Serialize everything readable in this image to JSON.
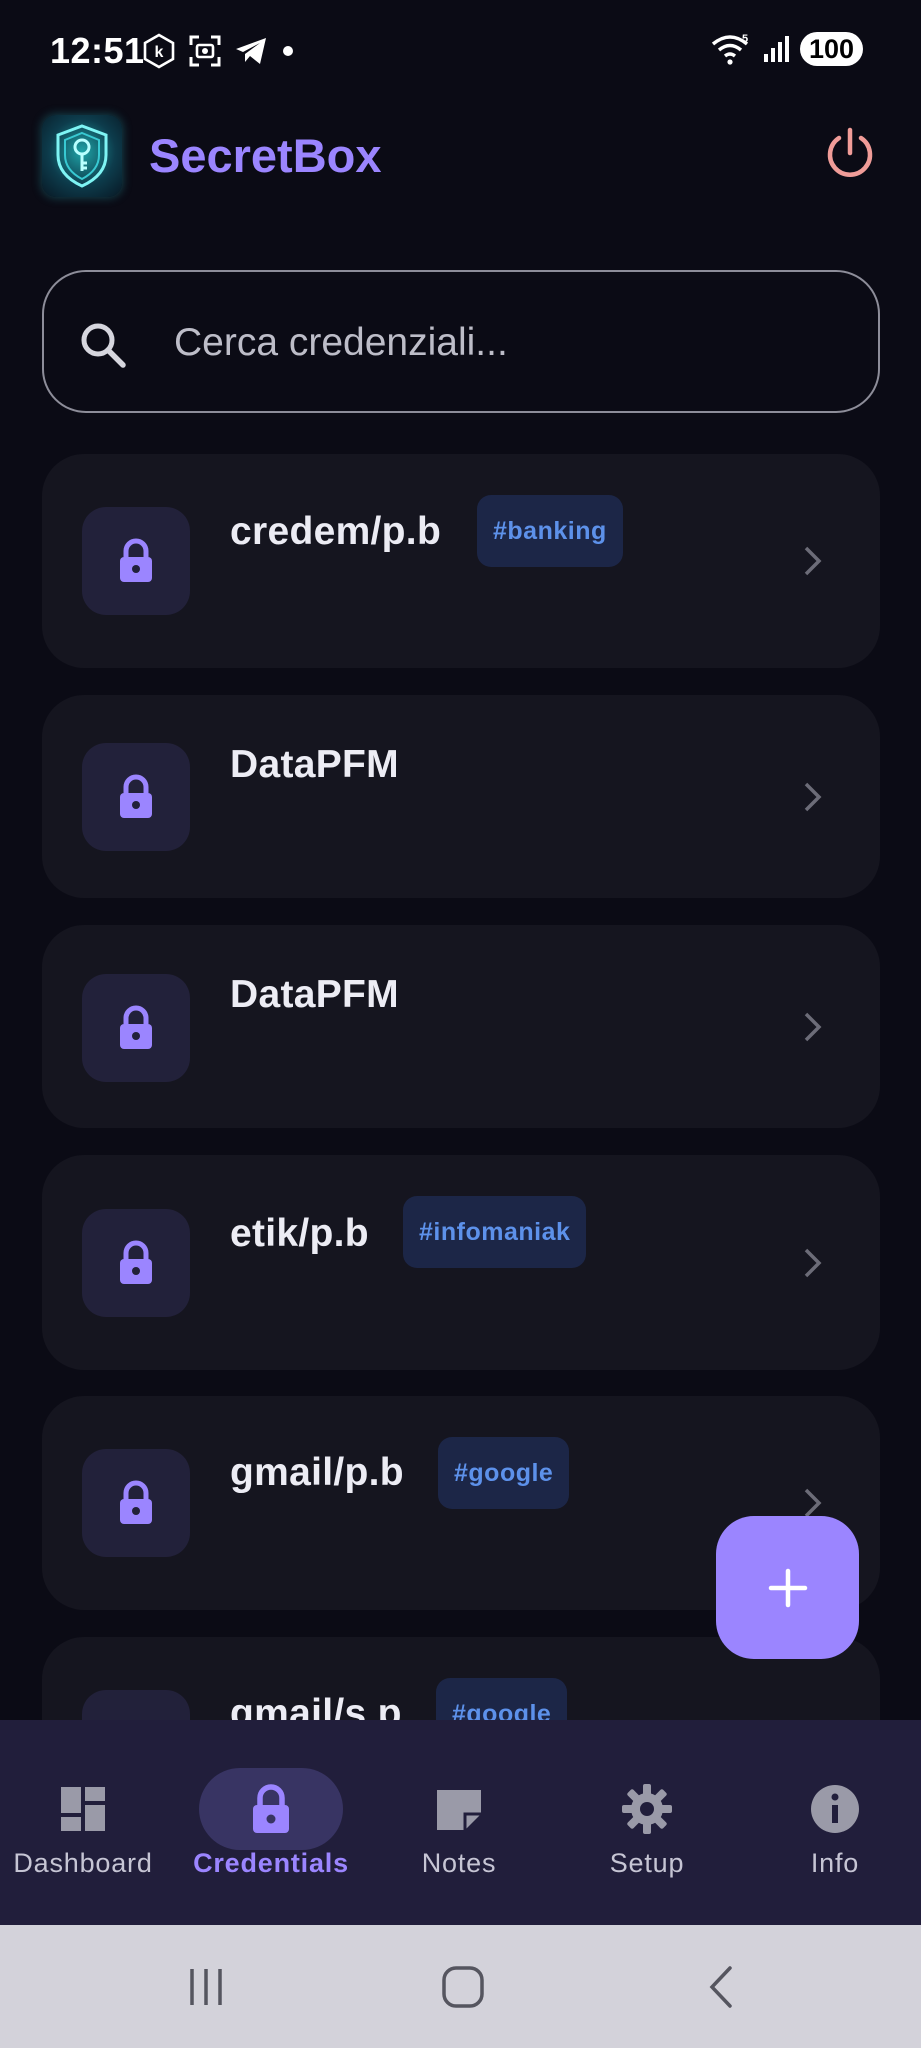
{
  "status_bar": {
    "time": "12:51",
    "battery": "100"
  },
  "header": {
    "title": "SecretBox"
  },
  "search": {
    "placeholder": "Cerca credenziali..."
  },
  "credentials": [
    {
      "title": "credem/p.b",
      "tag": "#banking"
    },
    {
      "title": "DataPFM",
      "tag": ""
    },
    {
      "title": "DataPFM",
      "tag": ""
    },
    {
      "title": "etik/p.b",
      "tag": "#infomaniak"
    },
    {
      "title": "gmail/p.b",
      "tag": "#google"
    },
    {
      "title": "gmail/s.p",
      "tag": "#google"
    }
  ],
  "fab": {
    "label": "+"
  },
  "nav": {
    "items": [
      {
        "label": "Dashboard",
        "icon": "dashboard-icon"
      },
      {
        "label": "Credentials",
        "icon": "lock-icon"
      },
      {
        "label": "Notes",
        "icon": "note-icon"
      },
      {
        "label": "Setup",
        "icon": "gear-icon"
      },
      {
        "label": "Info",
        "icon": "info-icon"
      }
    ],
    "active": "Credentials"
  },
  "colors": {
    "background": "#0b0b15",
    "card": "#15151f",
    "accent": "#9b85ff",
    "tag_bg": "#1c2647",
    "tag_text": "#5d91ea",
    "nav_bg": "#211e3b",
    "power": "#f09c98"
  }
}
